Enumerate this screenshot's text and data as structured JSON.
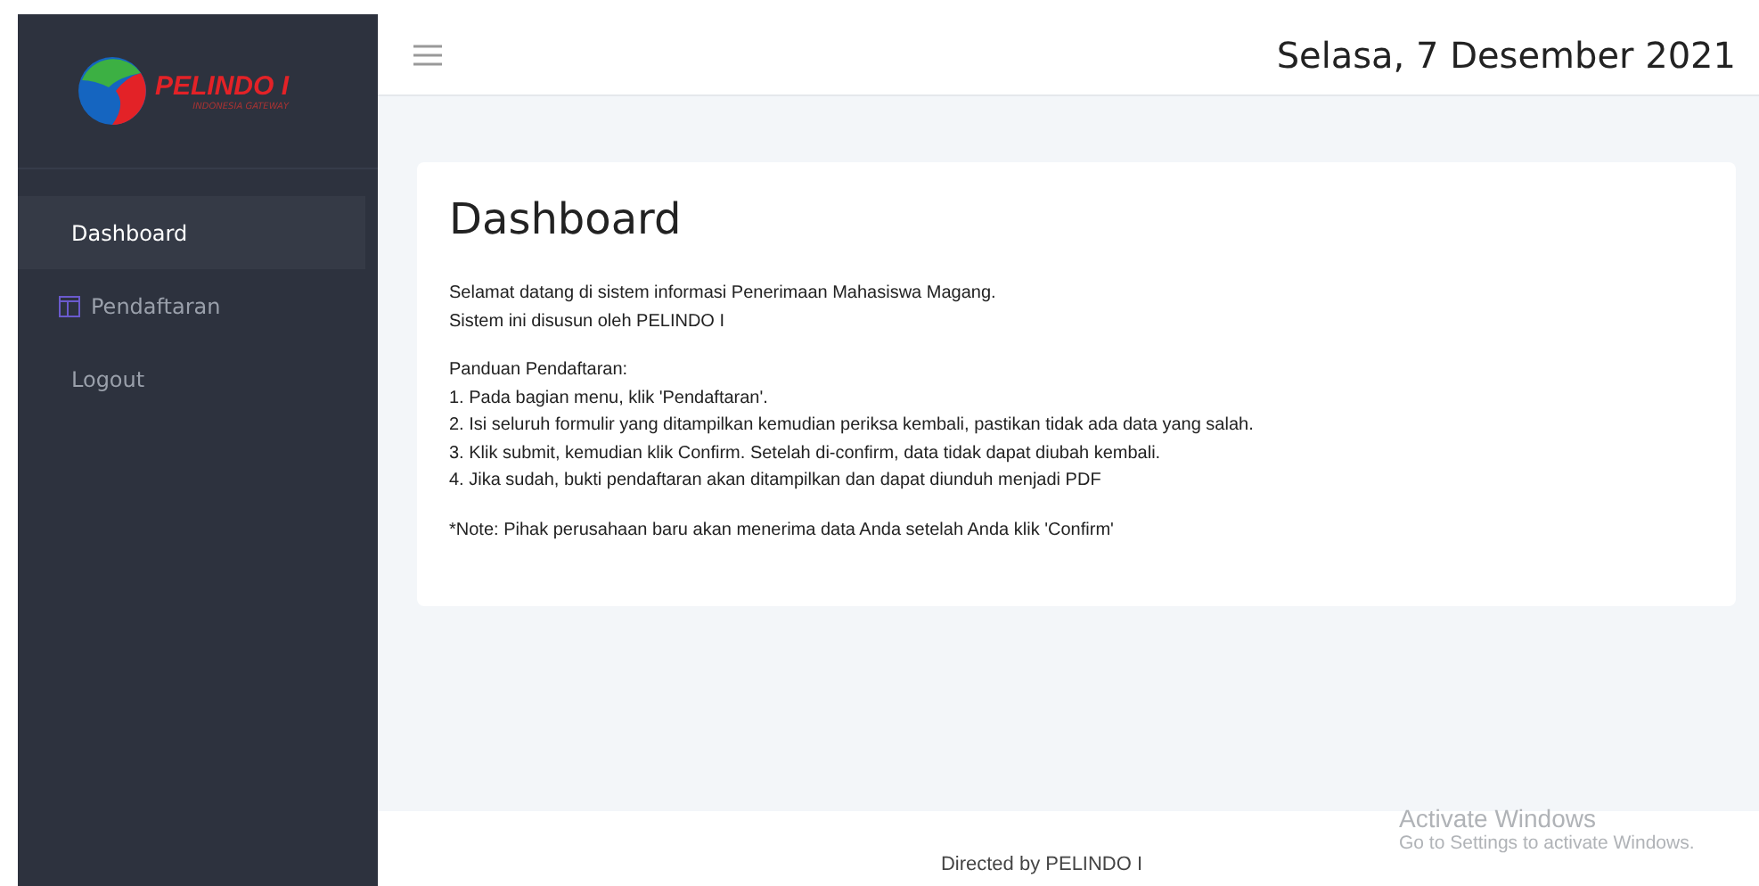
{
  "sidebar": {
    "logo": {
      "name": "PELINDO I",
      "tagline": "INDONESIA GATEWAY"
    },
    "items": [
      {
        "label": "Dashboard",
        "selected": true,
        "kind": "plain"
      },
      {
        "label": "Pendaftaran",
        "selected": false,
        "kind": "with-icon"
      },
      {
        "label": "Logout",
        "selected": false,
        "kind": "plain"
      }
    ]
  },
  "header": {
    "date": "Selasa, 7 Desember 2021"
  },
  "card": {
    "title": "Dashboard",
    "paragraphs": [
      [
        "Selamat datang di sistem informasi Penerimaan Mahasiswa Magang.",
        "Sistem ini disusun oleh PELINDO I"
      ],
      [
        "Panduan Pendaftaran:",
        "1. Pada bagian menu, klik 'Pendaftaran'.",
        "2. Isi seluruh formulir yang ditampilkan kemudian periksa kembali, pastikan tidak ada data yang salah.",
        "3. Klik submit, kemudian klik Confirm. Setelah di-confirm, data tidak dapat diubah kembali.",
        "4. Jika sudah, bukti pendaftaran akan ditampilkan dan dapat diunduh menjadi PDF"
      ],
      [
        "*Note: Pihak perusahaan baru akan menerima data Anda setelah Anda klik 'Confirm'"
      ]
    ]
  },
  "footer": {
    "text": "Directed by PELINDO I"
  },
  "os_overlay": {
    "title": "Activate Windows",
    "subtitle": "Go to Settings to activate Windows."
  }
}
